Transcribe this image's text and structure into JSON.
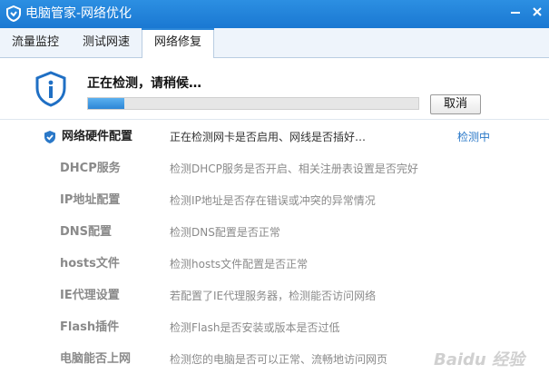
{
  "window": {
    "title": "电脑管家-网络优化"
  },
  "tabs": [
    {
      "label": "流量监控"
    },
    {
      "label": "测试网速"
    },
    {
      "label": "网络修复"
    }
  ],
  "status": {
    "text": "正在检测，请稍候…",
    "progress": 0.11,
    "cancel_label": "取消"
  },
  "items": [
    {
      "name": "网络硬件配置",
      "desc": "正在检测网卡是否启用、网线是否插好…",
      "state": "检测中"
    },
    {
      "name": "DHCP服务",
      "desc": "检测DHCP服务是否开启、相关注册表设置是否完好"
    },
    {
      "name": "IP地址配置",
      "desc": "检测IP地址是否存在错误或冲突的异常情况"
    },
    {
      "name": "DNS配置",
      "desc": "检测DNS配置是否正常"
    },
    {
      "name": "hosts文件",
      "desc": "检测hosts文件配置是否正常"
    },
    {
      "name": "IE代理设置",
      "desc": "若配置了IE代理服务器，检测能否访问网络"
    },
    {
      "name": "Flash插件",
      "desc": "检测Flash是否安装或版本是否过低"
    },
    {
      "name": "电脑能否上网",
      "desc": "检测您的电脑是否可以正常、流畅地访问网页"
    }
  ],
  "watermark": "Baidu 经验"
}
